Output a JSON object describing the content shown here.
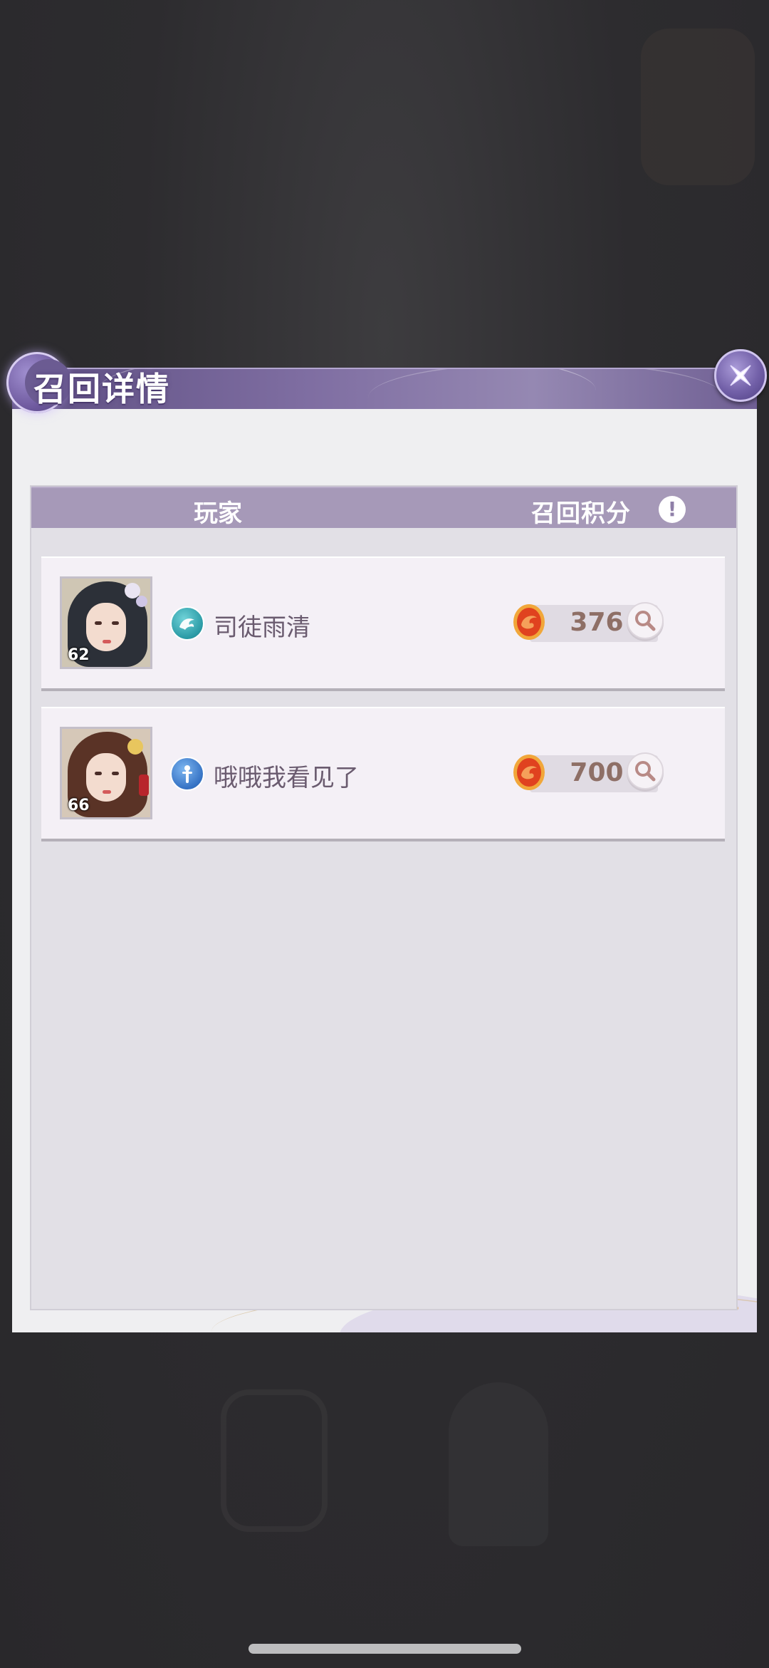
{
  "dialog": {
    "title": "召回详情",
    "close_icon": "close-x-icon"
  },
  "table": {
    "header_player": "玩家",
    "header_score": "召回积分",
    "info_icon_glyph": "!",
    "rows": [
      {
        "level": "62",
        "class_icon": "dragon-class-icon",
        "name": "司徒雨清",
        "score_icon": "recall-coin-icon",
        "score": "376"
      },
      {
        "level": "66",
        "class_icon": "sword-class-icon",
        "name": "哦哦我看见了",
        "score_icon": "recall-coin-icon",
        "score": "700"
      }
    ]
  },
  "colors": {
    "header_purple": "#a699b8",
    "title_purple": "#6f5f93",
    "score_text": "#8e6f66",
    "name_text": "#6a5b6f"
  }
}
